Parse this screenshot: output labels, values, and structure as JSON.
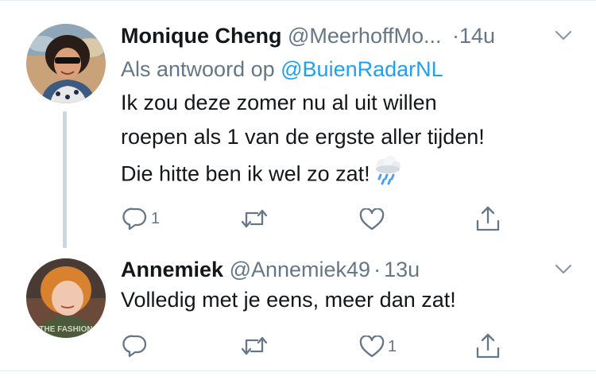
{
  "tweets": [
    {
      "author_name": "Monique Cheng",
      "handle": "@MeerhoffMo...",
      "separator": "·",
      "time": "14u",
      "reply_prefix": "Als antwoord op",
      "reply_mention": "@BuienRadarNL",
      "text_lines": [
        "Ik zou deze zomer nu al uit willen",
        "roepen als 1 van de ergste aller tijden!"
      ],
      "text_line3": "Die hitte ben ik wel zo zat!",
      "emoji_icon": "cloud-with-rain-icon",
      "reply_count": "1",
      "retweet_count": "",
      "like_count": "",
      "liked": false
    },
    {
      "author_name": "Annemiek",
      "handle": "@Annemiek49",
      "separator": "·",
      "time": "13u",
      "text": "Volledig met je eens, meer dan zat!",
      "reply_count": "",
      "retweet_count": "",
      "like_count": "1",
      "avatar_text": "THE FASHION"
    }
  ],
  "colors": {
    "text": "#14171a",
    "secondary": "#657786",
    "link": "#1da1f2",
    "divider": "#e6ecf0",
    "thread_line": "#ccd6dd"
  }
}
